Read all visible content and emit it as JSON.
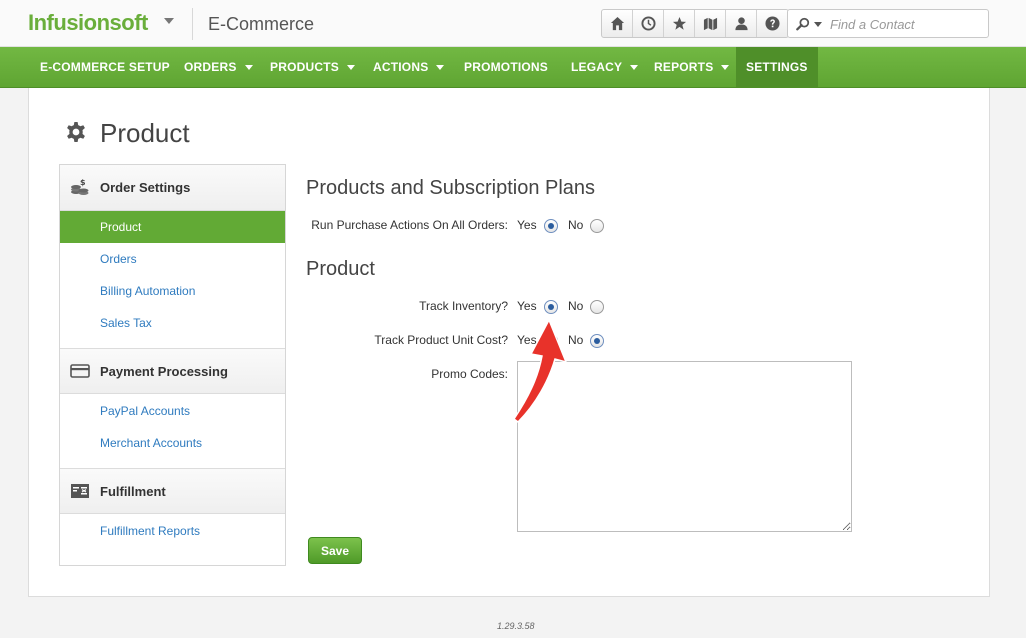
{
  "header": {
    "logo_text": "Infusionsoft",
    "app_title": "E-Commerce",
    "toolbar_icons": [
      "home-icon",
      "history-icon",
      "star-icon",
      "map-icon",
      "user-icon",
      "help-icon"
    ],
    "search_placeholder": "Find a Contact"
  },
  "nav": {
    "items": [
      {
        "label": "E-COMMERCE SETUP",
        "has_dropdown": false
      },
      {
        "label": "ORDERS",
        "has_dropdown": true
      },
      {
        "label": "PRODUCTS",
        "has_dropdown": true
      },
      {
        "label": "ACTIONS",
        "has_dropdown": true
      },
      {
        "label": "PROMOTIONS",
        "has_dropdown": false
      },
      {
        "label": "LEGACY",
        "has_dropdown": true
      },
      {
        "label": "REPORTS",
        "has_dropdown": true
      },
      {
        "label": "SETTINGS",
        "has_dropdown": false,
        "active": true
      }
    ]
  },
  "page": {
    "title": "Product"
  },
  "sidebar": {
    "sections": [
      {
        "title": "Order Settings",
        "icon": "coins-icon",
        "links": [
          "Product",
          "Orders",
          "Billing Automation",
          "Sales Tax"
        ],
        "active_link": "Product"
      },
      {
        "title": "Payment Processing",
        "icon": "credit-card-icon",
        "links": [
          "PayPal Accounts",
          "Merchant Accounts"
        ]
      },
      {
        "title": "Fulfillment",
        "icon": "invoice-icon",
        "links": [
          "Fulfillment Reports"
        ]
      }
    ]
  },
  "form": {
    "section1_title": "Products and Subscription Plans",
    "run_purchase_actions": {
      "label": "Run Purchase Actions On All Orders:",
      "yes_label": "Yes",
      "no_label": "No",
      "value": "Yes"
    },
    "section2_title": "Product",
    "track_inventory": {
      "label": "Track Inventory?",
      "yes_label": "Yes",
      "no_label": "No",
      "value": "Yes"
    },
    "track_unit_cost": {
      "label": "Track Product Unit Cost?",
      "yes_label": "Yes",
      "no_label": "No",
      "value": "No"
    },
    "promo_codes": {
      "label": "Promo Codes:",
      "value": ""
    },
    "save_label": "Save"
  },
  "footer": {
    "version": "1.29.3.58"
  },
  "colors": {
    "brand_green": "#6aae3b",
    "nav_green": "#62aa35",
    "link_blue": "#2f7bbf",
    "annotation_red": "#e8322a"
  }
}
